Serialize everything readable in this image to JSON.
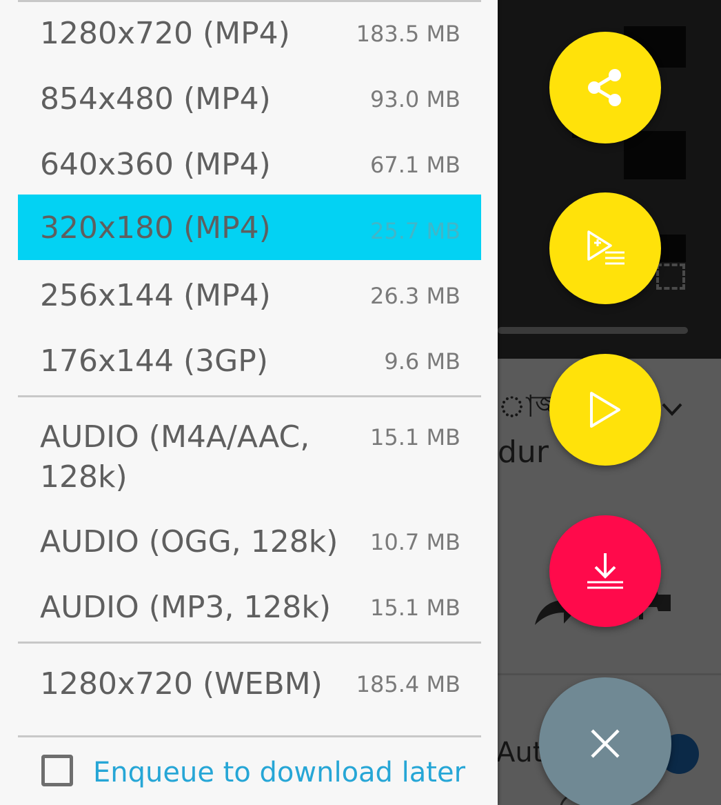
{
  "background": {
    "title_fragment": "াজ্জ",
    "title_fragment_2": "dur",
    "autoplay_fragment": "Auto"
  },
  "menu": {
    "video_formats": [
      {
        "label": "1280x720 (MP4)",
        "size": "183.5 MB"
      },
      {
        "label": "854x480 (MP4)",
        "size": "93.0 MB"
      },
      {
        "label": "640x360 (MP4)",
        "size": "67.1 MB"
      },
      {
        "label": "320x180 (MP4)",
        "size": "25.7 MB",
        "selected": true
      },
      {
        "label": "256x144 (MP4)",
        "size": "26.3 MB"
      },
      {
        "label": "176x144 (3GP)",
        "size": "9.6 MB"
      }
    ],
    "audio_formats": [
      {
        "label": "AUDIO (M4A/AAC,\n128k)",
        "size": "15.1 MB"
      },
      {
        "label": "AUDIO (OGG, 128k)",
        "size": "10.7 MB"
      },
      {
        "label": "AUDIO (MP3, 128k)",
        "size": "15.1 MB"
      }
    ],
    "webm_formats": [
      {
        "label": "1280x720 (WEBM)",
        "size": "185.4 MB"
      }
    ],
    "enqueue_checkbox": {
      "label": "Enqueue to download later",
      "checked": false
    }
  },
  "fabs": [
    {
      "name": "share-button",
      "icon": "share-icon",
      "color": "#ffe20a"
    },
    {
      "name": "add-to-playlist-button",
      "icon": "playlist-add-icon",
      "color": "#ffe20a"
    },
    {
      "name": "play-button",
      "icon": "play-icon",
      "color": "#ffe20a"
    },
    {
      "name": "download-button",
      "icon": "download-icon",
      "color": "#ff0a4b"
    },
    {
      "name": "close-button",
      "icon": "close-icon",
      "color": "#708994"
    }
  ],
  "colors": {
    "selected_row": "#03d2f3",
    "link_text": "#26a6d6",
    "fab_yellow": "#ffe20a",
    "fab_red": "#ff0a4b",
    "fab_grey": "#708994"
  }
}
